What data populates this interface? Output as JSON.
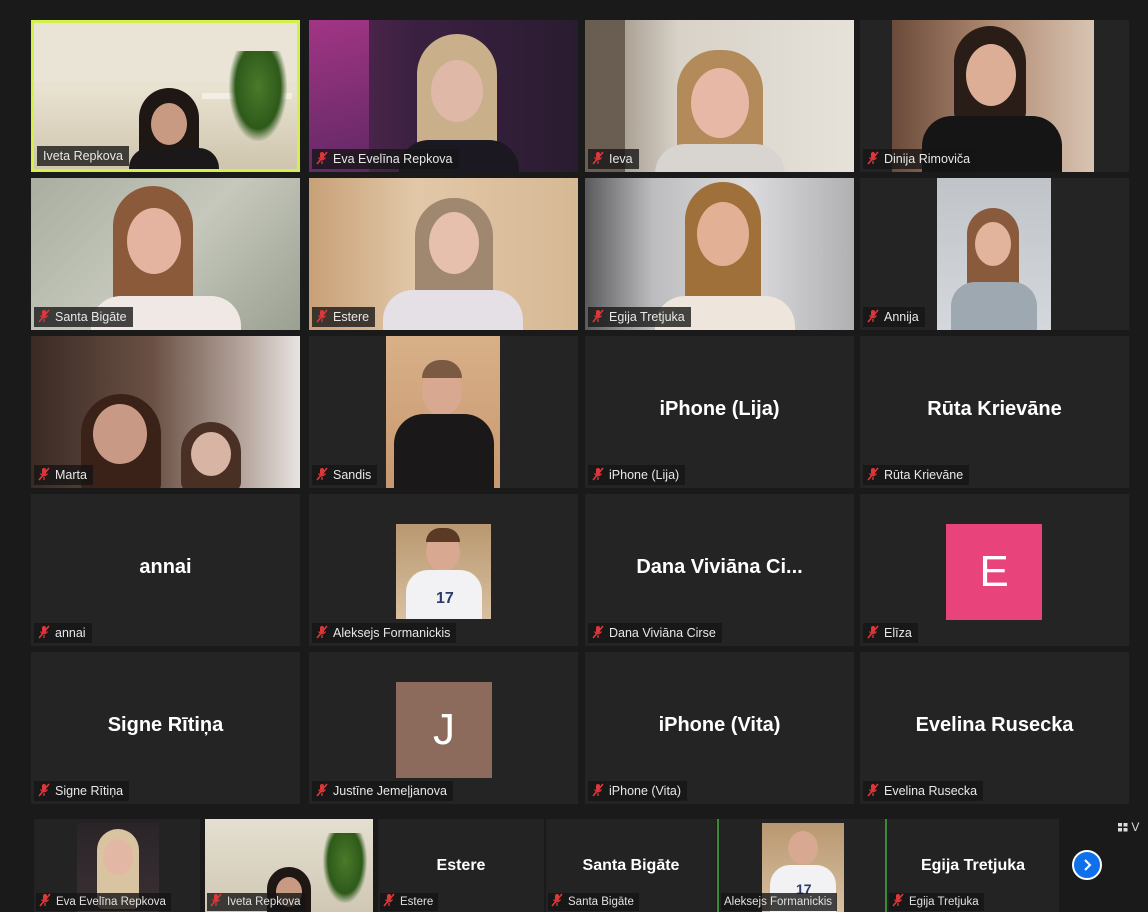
{
  "participants": {
    "r0c0": {
      "label": "Iveta Repkova"
    },
    "r0c1": {
      "label": "Eva Evelīna Repkova"
    },
    "r0c2": {
      "label": "Ieva"
    },
    "r0c3": {
      "label": "Dinija Rimoviča"
    },
    "r1c0": {
      "label": "Santa Bigāte"
    },
    "r1c1": {
      "label": "Estere"
    },
    "r1c2": {
      "label": "Egija Tretjuka"
    },
    "r1c3": {
      "label": "Annija"
    },
    "r2c0": {
      "label": "Marta"
    },
    "r2c1": {
      "label": "Sandis"
    },
    "r2c2": {
      "label": "iPhone (Lija)",
      "display": "iPhone (Lija)"
    },
    "r2c3": {
      "label": "Rūta Krievāne",
      "display": "Rūta Krievāne"
    },
    "r3c0": {
      "label": "annai",
      "display": "annai"
    },
    "r3c1": {
      "label": "Aleksejs Formanickis"
    },
    "r3c2": {
      "label": "Dana Viviāna Cirse",
      "display": "Dana Viviāna Ci..."
    },
    "r3c3": {
      "label": "Elīza",
      "avatar_letter": "E"
    },
    "r4c0": {
      "label": "Signe Rītiņa",
      "display": "Signe Rītiņa"
    },
    "r4c1": {
      "label": "Justīne Jemeļjanova",
      "avatar_letter": "J"
    },
    "r4c2": {
      "label": "iPhone (Vita)",
      "display": "iPhone (Vita)"
    },
    "r4c3": {
      "label": "Evelina Rusecka",
      "display": "Evelina Rusecka"
    }
  },
  "strip": {
    "s0": {
      "label": "Eva Evelīna Repkova"
    },
    "s1": {
      "label": "Iveta Repkova"
    },
    "s2": {
      "label": "Estere",
      "display": "Estere"
    },
    "s3": {
      "label": "Santa Bigāte",
      "display": "Santa Bigāte"
    },
    "s4": {
      "label": "Aleksejs Formanickis"
    },
    "s5": {
      "label": "Egija Tretjuka",
      "display": "Egija Tretjuka"
    }
  },
  "view_button": {
    "label": "V"
  },
  "colors": {
    "active_speaker_border": "#d4f04a",
    "muted_mic": "#e0363a",
    "avatar_e": "#e8437a",
    "avatar_j": "#8c6b5d",
    "next_button": "#0e71eb"
  },
  "icons": {
    "mic": "muted-mic-icon",
    "next": "chevron-right-icon",
    "view": "grid-view-icon"
  }
}
